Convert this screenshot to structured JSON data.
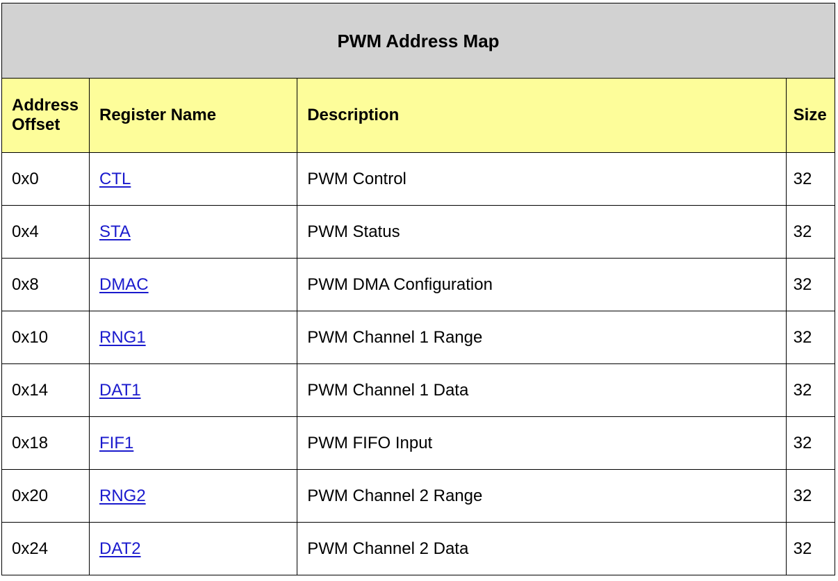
{
  "colors": {
    "title_bg": "#d2d2d2",
    "header_bg": "#fdfd9a",
    "link": "#1a1acd",
    "border": "#000000"
  },
  "table": {
    "title": "PWM Address Map",
    "headers": {
      "offset": "Address Offset",
      "name": "Register Name",
      "description": "Description",
      "size": "Size"
    },
    "rows": [
      {
        "offset": "0x0",
        "name": "CTL",
        "description": "PWM Control",
        "size": "32"
      },
      {
        "offset": "0x4",
        "name": "STA",
        "description": "PWM Status",
        "size": "32"
      },
      {
        "offset": "0x8",
        "name": "DMAC",
        "description": "PWM DMA Configuration",
        "size": "32"
      },
      {
        "offset": "0x10",
        "name": "RNG1",
        "description": "PWM Channel 1 Range",
        "size": "32"
      },
      {
        "offset": "0x14",
        "name": "DAT1",
        "description": "PWM Channel 1 Data",
        "size": "32"
      },
      {
        "offset": "0x18",
        "name": "FIF1",
        "description": "PWM FIFO Input",
        "size": "32"
      },
      {
        "offset": "0x20",
        "name": "RNG2",
        "description": "PWM Channel 2 Range",
        "size": "32"
      },
      {
        "offset": "0x24",
        "name": "DAT2",
        "description": "PWM Channel 2 Data",
        "size": "32"
      }
    ]
  }
}
